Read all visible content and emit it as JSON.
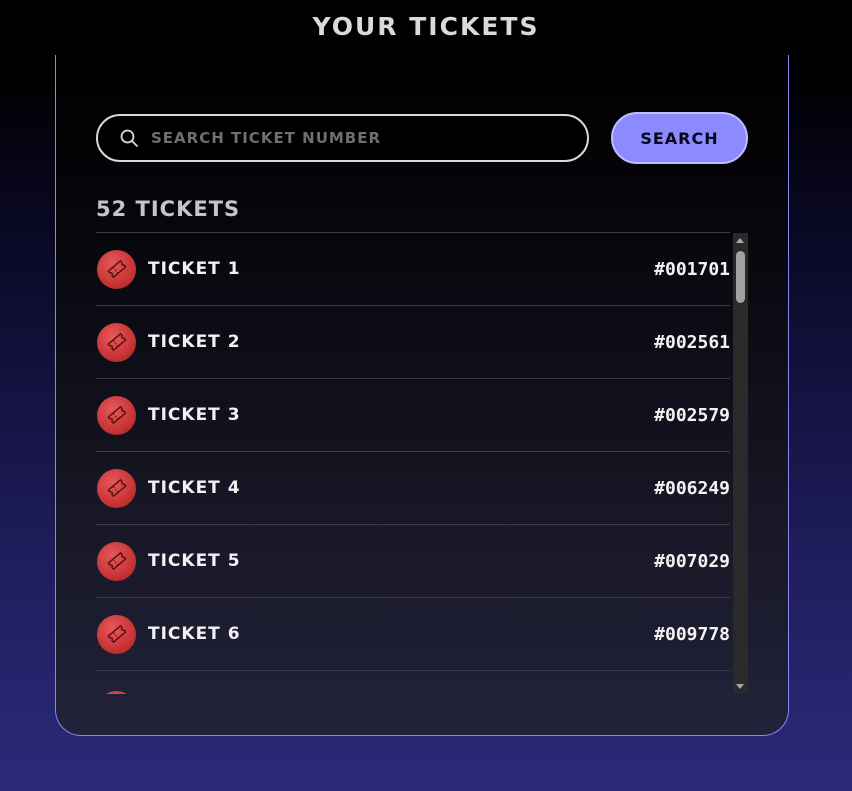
{
  "header": {
    "title": "YOUR TICKETS"
  },
  "search": {
    "placeholder": "SEARCH TICKET NUMBER",
    "value": "",
    "button_label": "SEARCH",
    "icon": "search-icon"
  },
  "summary": {
    "count_label": "52 TICKETS"
  },
  "tickets": [
    {
      "label": "TICKET 1",
      "number": "#001701",
      "icon": "ticket-icon"
    },
    {
      "label": "TICKET 2",
      "number": "#002561",
      "icon": "ticket-icon"
    },
    {
      "label": "TICKET 3",
      "number": "#002579",
      "icon": "ticket-icon"
    },
    {
      "label": "TICKET 4",
      "number": "#006249",
      "icon": "ticket-icon"
    },
    {
      "label": "TICKET 5",
      "number": "#007029",
      "icon": "ticket-icon"
    },
    {
      "label": "TICKET 6",
      "number": "#009778",
      "icon": "ticket-icon"
    }
  ],
  "colors": {
    "accent": "#8c8aff",
    "panel_border": "#8a87f0",
    "ticket_badge": "#d1393b"
  }
}
